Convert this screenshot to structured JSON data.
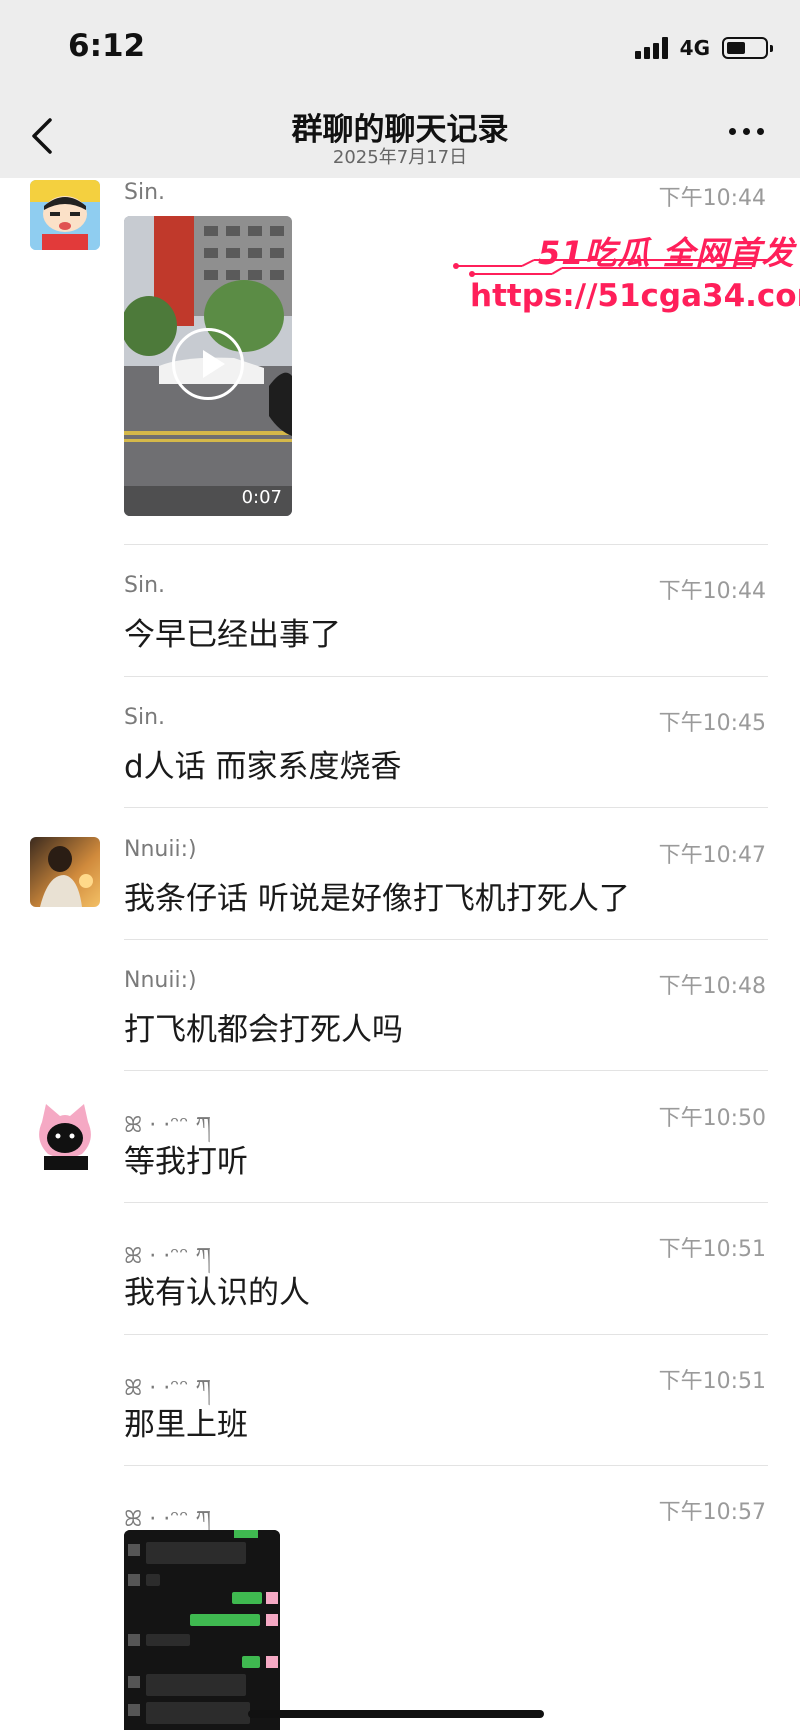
{
  "status_bar": {
    "time": "6:12",
    "network": "4G",
    "battery_level": 0.5
  },
  "nav": {
    "title": "群聊的聊天记录",
    "subtitle": "2025年7月17日"
  },
  "watermark": {
    "brand": "51吃瓜 全网首发",
    "url": "https://51cga34.com"
  },
  "messages": [
    {
      "sender": "Sin.",
      "time": "下午10:44",
      "type": "video",
      "duration": "0:07",
      "avatar": "cartoon-avatar-icon"
    },
    {
      "sender": "Sin.",
      "time": "下午10:44",
      "type": "text",
      "text": "今早已经出事了"
    },
    {
      "sender": "Sin.",
      "time": "下午10:45",
      "type": "text",
      "text": "d人话 而家系度烧香"
    },
    {
      "sender": "Nnuii:)",
      "time": "下午10:47",
      "type": "text",
      "text": "我条仔话 听说是好像打飞机打死人了",
      "avatar": "photo-avatar-icon"
    },
    {
      "sender": "Nnuii:)",
      "time": "下午10:48",
      "type": "text",
      "text": "打飞机都会打死人吗"
    },
    {
      "sender": "ꕤ · ·ᵔᵔ ཀ",
      "time": "下午10:50",
      "type": "text",
      "text": "等我打听",
      "avatar": "pink-cat-avatar-icon"
    },
    {
      "sender": "ꕤ · ·ᵔᵔ ཀ",
      "time": "下午10:51",
      "type": "text",
      "text": "我有认识的人"
    },
    {
      "sender": "ꕤ · ·ᵔᵔ ཀ",
      "time": "下午10:51",
      "type": "text",
      "text": "那里上班"
    },
    {
      "sender": "ꕤ · ·ᵔᵔ ཀ",
      "time": "下午10:57",
      "type": "image"
    }
  ]
}
